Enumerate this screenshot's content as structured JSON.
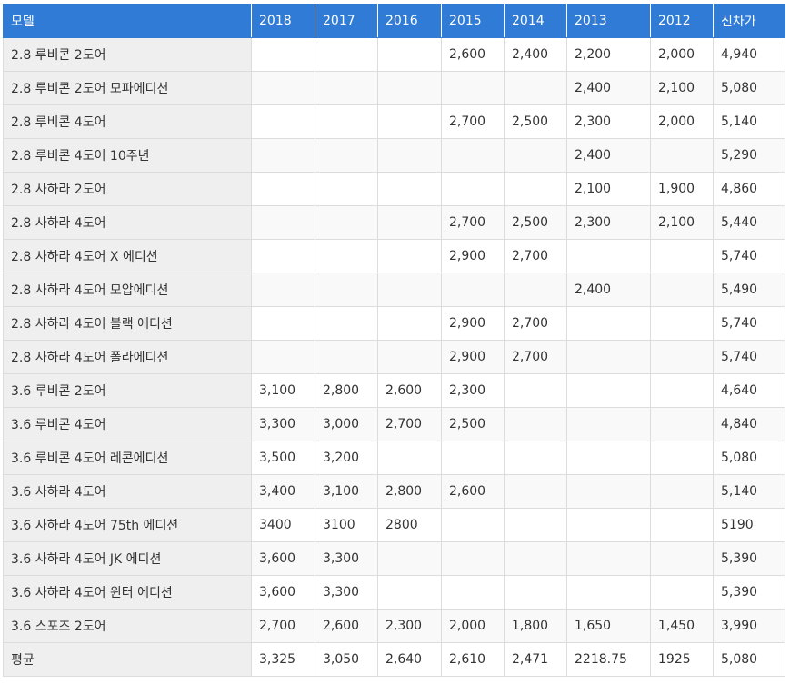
{
  "table": {
    "headers": [
      "모델",
      "2018",
      "2017",
      "2016",
      "2015",
      "2014",
      "2013",
      "2012",
      "신차가"
    ],
    "rows": [
      [
        "2.8 루비콘 2도어",
        "",
        "",
        "",
        "2,600",
        "2,400",
        "2,200",
        "2,000",
        "4,940"
      ],
      [
        "2.8 루비콘 2도어 모파에디션",
        "",
        "",
        "",
        "",
        "",
        "2,400",
        "2,100",
        "5,080"
      ],
      [
        "2.8 루비콘 4도어",
        "",
        "",
        "",
        "2,700",
        "2,500",
        "2,300",
        "2,000",
        "5,140"
      ],
      [
        "2.8 루비콘 4도어 10주년",
        "",
        "",
        "",
        "",
        "",
        "2,400",
        "",
        "5,290"
      ],
      [
        "2.8 사하라 2도어",
        "",
        "",
        "",
        "",
        "",
        "2,100",
        "1,900",
        "4,860"
      ],
      [
        "2.8 사하라 4도어",
        "",
        "",
        "",
        "2,700",
        "2,500",
        "2,300",
        "2,100",
        "5,440"
      ],
      [
        "2.8 사하라 4도어 X 에디션",
        "",
        "",
        "",
        "2,900",
        "2,700",
        "",
        "",
        "5,740"
      ],
      [
        "2.8 사하라 4도어 모압에디션",
        "",
        "",
        "",
        "",
        "",
        "2,400",
        "",
        "5,490"
      ],
      [
        "2.8 사하라 4도어 블랙 에디션",
        "",
        "",
        "",
        "2,900",
        "2,700",
        "",
        "",
        "5,740"
      ],
      [
        "2.8 사하라 4도어 폴라에디션",
        "",
        "",
        "",
        "2,900",
        "2,700",
        "",
        "",
        "5,740"
      ],
      [
        "3.6 루비콘 2도어",
        "3,100",
        "2,800",
        "2,600",
        "2,300",
        "",
        "",
        "",
        "4,640"
      ],
      [
        "3.6 루비콘 4도어",
        "3,300",
        "3,000",
        "2,700",
        "2,500",
        "",
        "",
        "",
        "4,840"
      ],
      [
        "3.6 루비콘 4도어 레콘에디션",
        "3,500",
        "3,200",
        "",
        "",
        "",
        "",
        "",
        "5,080"
      ],
      [
        "3.6 사하라 4도어",
        "3,400",
        "3,100",
        "2,800",
        "2,600",
        "",
        "",
        "",
        "5,140"
      ],
      [
        "3.6 사하라 4도어 75th 에디션",
        "3400",
        "3100",
        "2800",
        "",
        "",
        "",
        "",
        "5190"
      ],
      [
        "3.6 사하라 4도어 JK 에디션",
        "3,600",
        "3,300",
        "",
        "",
        "",
        "",
        "",
        "5,390"
      ],
      [
        "3.6 사하라 4도어 윈터 에디션",
        "3,600",
        "3,300",
        "",
        "",
        "",
        "",
        "",
        "5,390"
      ],
      [
        "3.6 스포즈 2도어",
        "2,700",
        "2,600",
        "2,300",
        "2,000",
        "1,800",
        "1,650",
        "1,450",
        "3,990"
      ],
      [
        "평균",
        "3,325",
        "3,050",
        "2,640",
        "2,610",
        "2,471",
        "2218.75",
        "1925",
        "5,080"
      ]
    ]
  }
}
